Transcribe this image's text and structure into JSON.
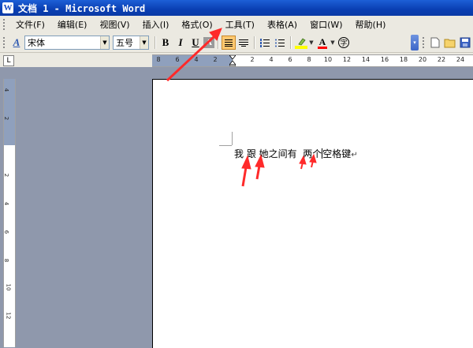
{
  "window": {
    "title": "文档 1 - Microsoft Word",
    "icon": "word-icon"
  },
  "menu": [
    "文件(F)",
    "编辑(E)",
    "视图(V)",
    "插入(I)",
    "格式(O)",
    "工具(T)",
    "表格(A)",
    "窗口(W)",
    "帮助(H)"
  ],
  "toolbar": {
    "font_name": "宋体",
    "font_size": "五号",
    "bold": "B",
    "italic": "I",
    "underline": "U",
    "char_shade": "A",
    "font_color": "A",
    "circle_char": "字"
  },
  "ruler": {
    "tab_selector": "L",
    "h_numbers": [
      "8",
      "6",
      "4",
      "2",
      "2",
      "4",
      "6",
      "8",
      "10",
      "12",
      "14",
      "16",
      "18",
      "20",
      "22",
      "24"
    ],
    "v_numbers": [
      "4",
      "2",
      "2",
      "4",
      "6",
      "8",
      "10",
      "12"
    ]
  },
  "document": {
    "line_parts": [
      "我 ",
      "跟",
      " 她之间有  两个",
      "空格键"
    ],
    "paragraph_mark": "↵"
  },
  "annotation_color": "#ff2a2a"
}
